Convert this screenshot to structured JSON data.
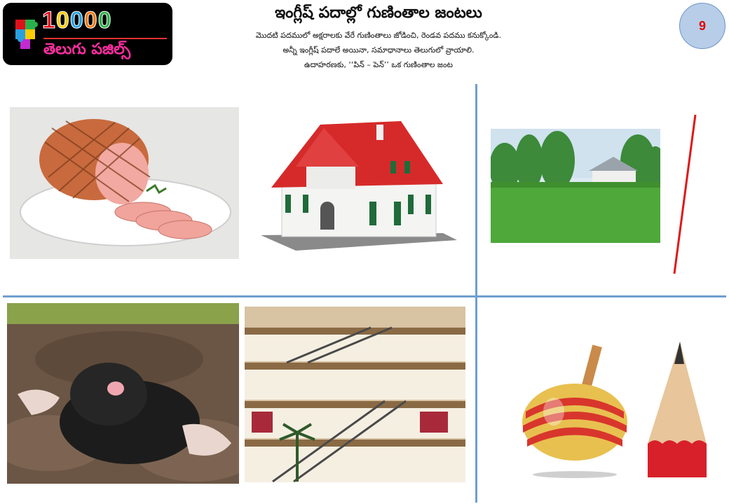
{
  "logo": {
    "digits": [
      "1",
      "0",
      "0",
      "0",
      "0"
    ],
    "digit_colors": [
      "#e0101a",
      "#ffcc00",
      "#28a0e0",
      "#f07a14",
      "#2ab04a"
    ],
    "subtitle": "తెలుగు పజిల్స్"
  },
  "header": {
    "title": "ఇంగ్లీష్ పదాల్లో గుణింతాల జంటలు",
    "instruction_lines": [
      "మొదటి పదములో అక్షరాలకు వేరే గుణింతాలు జోడించి, రెండవ పదము కనుక్కోండి.",
      "అన్నీ ఇంగ్లీష్ పదాలే అయినా, సమాధానాలు తెలుగులో వ్రాయాలి.",
      "ఉదాహరణకు, ‘‘పిన్ – పెన్’’ ఒక గుణింతాల జంట"
    ]
  },
  "puzzle_number": "9",
  "pictures": [
    {
      "name": "ham-image",
      "icon": "ham"
    },
    {
      "name": "house-image",
      "icon": "house"
    },
    {
      "name": "lawn-image",
      "icon": "lawn"
    },
    {
      "name": "line-image",
      "icon": "line"
    },
    {
      "name": "mole-image",
      "icon": "mole"
    },
    {
      "name": "mall-image",
      "icon": "mall"
    },
    {
      "name": "top-image",
      "icon": "spinning-top"
    },
    {
      "name": "pencil-image",
      "icon": "pencil"
    }
  ],
  "colors": {
    "divider": "#6f9fd0",
    "badge_fill": "#b7cde8",
    "badge_text": "#e00000"
  }
}
